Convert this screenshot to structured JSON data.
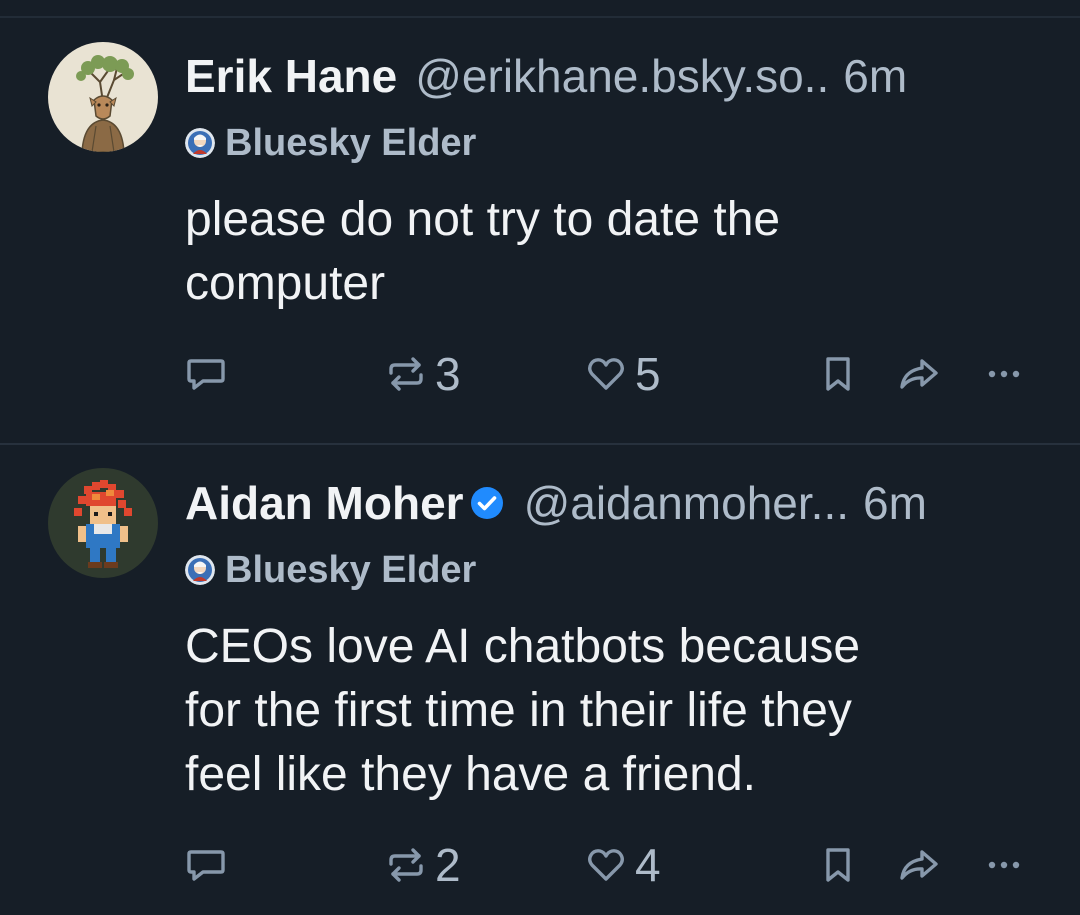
{
  "posts": [
    {
      "display_name": "Erik Hane",
      "verified": false,
      "handle": "@erikhane.bsky.so..",
      "time": "6m",
      "badge": "Bluesky Elder",
      "text_lines": [
        "please do not try to date the",
        "computer"
      ],
      "reposts": "3",
      "likes": "5",
      "avatar": "deer-with-tree-antlers-illustration"
    },
    {
      "display_name": "Aidan Moher",
      "verified": true,
      "handle": "@aidanmoher...",
      "time": "6m",
      "badge": "Bluesky Elder",
      "text_lines": [
        "CEOs love AI chatbots because",
        "for the first time in their life they",
        "feel like they have a friend."
      ],
      "reposts": "2",
      "likes": "4",
      "avatar": "pixel-art-red-haired-character"
    }
  ],
  "icons": {
    "reply": "speech-bubble-icon",
    "repost": "repost-arrows-icon",
    "like": "heart-icon",
    "bookmark": "bookmark-icon",
    "share": "share-arrow-icon",
    "more": "ellipsis-icon",
    "verified": "verified-check-icon",
    "badge": "bluesky-elder-badge-icon"
  },
  "colors": {
    "background": "#161e27",
    "text": "#f1f3f5",
    "muted": "#aebbc9",
    "icon": "#8798ab",
    "verified": "#208bfe",
    "divider": "#27313d"
  }
}
